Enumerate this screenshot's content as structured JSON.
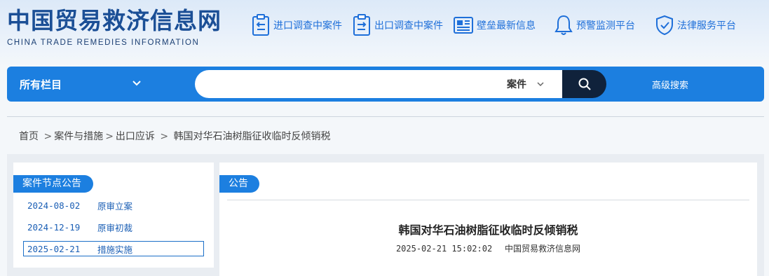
{
  "logo": {
    "title_cn": "中国贸易救济信息网",
    "title_en": "CHINA TRADE REMEDIES INFORMATION"
  },
  "top_nav": [
    {
      "label": "进口调查中案件",
      "icon": "clipboard-in-icon"
    },
    {
      "label": "出口调查中案件",
      "icon": "clipboard-out-icon"
    },
    {
      "label": "壁垒最新信息",
      "icon": "news-icon"
    },
    {
      "label": "预警监测平台",
      "icon": "bell-icon"
    },
    {
      "label": "法律服务平台",
      "icon": "shield-check-icon"
    }
  ],
  "search": {
    "category_label": "所有栏目",
    "placeholder": "",
    "type_label": "案件",
    "advanced_label": "高级搜索"
  },
  "breadcrumb": {
    "home": "首页",
    "level1": "案件与措施",
    "level2": "出口应诉",
    "current": "韩国对华石油树脂征收临时反倾销税"
  },
  "case_nodes": {
    "tab_label": "案件节点公告",
    "items": [
      {
        "date": "2024-08-02",
        "name": "原审立案",
        "active": false
      },
      {
        "date": "2024-12-19",
        "name": "原审初裁",
        "active": false
      },
      {
        "date": "2025-02-21",
        "name": "措施实施",
        "active": true
      }
    ]
  },
  "announcement": {
    "tab_label": "公告",
    "title": "韩国对华石油树脂征收临时反倾销税",
    "datetime": "2025-02-21 15:02:02",
    "source": "中国贸易救济信息网"
  },
  "colors": {
    "brand_blue": "#1c7fe0",
    "logo_blue": "#1b4f96",
    "search_button": "#10223b",
    "link_blue": "#1e6fd9"
  }
}
